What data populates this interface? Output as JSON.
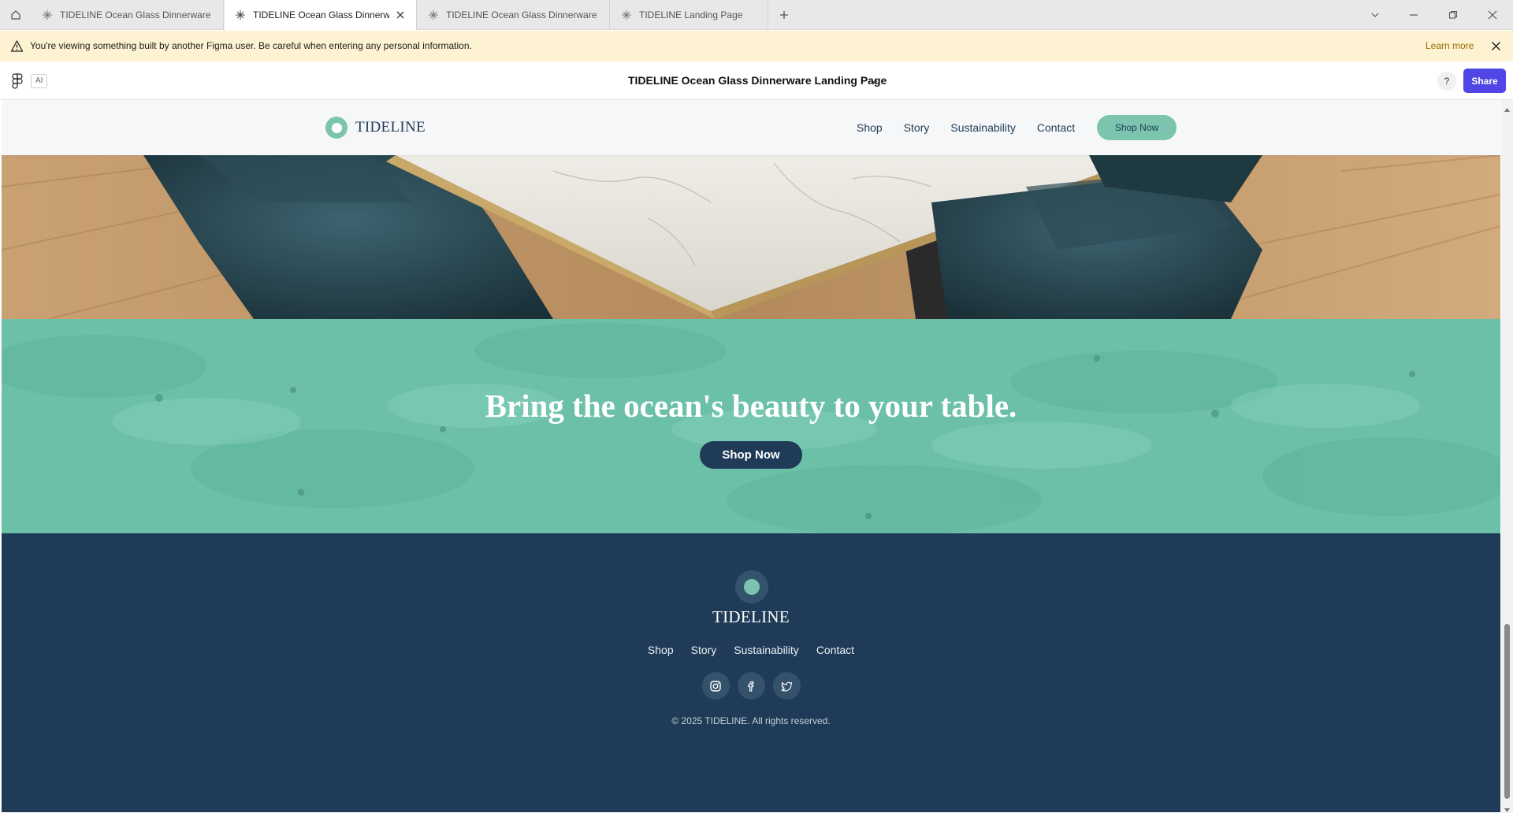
{
  "browser": {
    "tabs": [
      {
        "label": "TIDELINE Ocean Glass Dinnerware La",
        "active": false
      },
      {
        "label": "TIDELINE Ocean Glass Dinnerwa",
        "active": true
      },
      {
        "label": "TIDELINE Ocean Glass Dinnerware St",
        "active": false
      },
      {
        "label": "TIDELINE Landing Page",
        "active": false
      }
    ]
  },
  "warning": {
    "message": "You're viewing something built by another Figma user. Be careful when entering any personal information.",
    "learn_more": "Learn more"
  },
  "figma": {
    "ai_badge": "AI",
    "document_title": "TIDELINE Ocean Glass Dinnerware Landing Page",
    "help": "?",
    "share": "Share"
  },
  "site": {
    "brand": "TIDELINE",
    "nav": [
      "Shop",
      "Story",
      "Sustainability",
      "Contact"
    ],
    "nav_cta": "Shop Now",
    "cta_heading": "Bring the ocean's beauty to your table.",
    "cta_button": "Shop Now",
    "footer": {
      "brand": "TIDELINE",
      "nav": [
        "Shop",
        "Story",
        "Sustainability",
        "Contact"
      ],
      "socials": [
        "instagram-icon",
        "facebook-icon",
        "twitter-icon"
      ],
      "copyright": "© 2025 TIDELINE. All rights reserved."
    }
  },
  "colors": {
    "navy": "#1f3b57",
    "seafoam": "#7cc4ae",
    "share_button": "#4f46e5",
    "warning_bg": "#fdf3d2"
  }
}
